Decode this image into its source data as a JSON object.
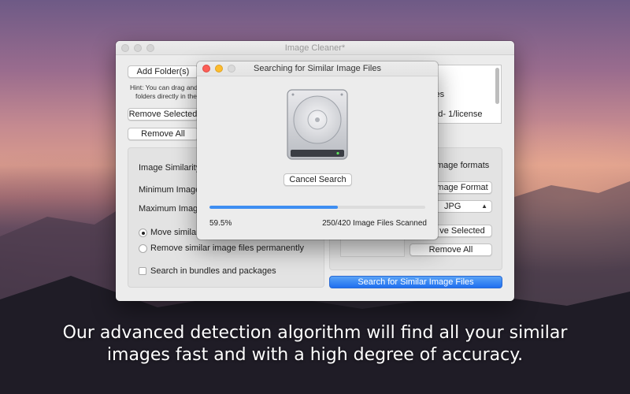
{
  "window": {
    "title": "Image Cleaner*",
    "add_folders_label": "Add Folder(s)",
    "hint_line1": "Hint: You can drag and",
    "hint_line2": "folders directly in the",
    "remove_selected_label": "Remove Selected",
    "remove_all_label": "Remove All",
    "folder_list": [
      "ples",
      "ned- 1/license"
    ],
    "left_group": {
      "image_similarity_label": "Image Similarity",
      "minimum_label": "Minimum Image",
      "maximum_label": "Maximum Image",
      "move_similar_label": "Move similar i",
      "remove_permanently_label": "Remove similar image files permanently",
      "search_bundles_label": "Search in bundles and packages"
    },
    "right_group": {
      "image_formats_label": "mage formats",
      "add_format_label": "mage Format",
      "format_value": "JPG",
      "remove_selected_label": "ve Selected",
      "remove_all_label": "Remove All"
    },
    "search_button_label": "Search for Similar Image Files"
  },
  "dialog": {
    "title": "Searching for Similar Image Files",
    "cancel_label": "Cancel Search",
    "progress": 0.595,
    "percent_text": "59.5%",
    "scanned_text": "250/420 Image Files Scanned",
    "icon": "hard-disk-icon"
  },
  "caption": {
    "line1": "Our advanced detection algorithm will find all your similar",
    "line2": "images fast and with a high degree of accuracy."
  },
  "colors": {
    "accent": "#3e8ef2",
    "close": "#fc5f57",
    "minimize": "#fdbc2e"
  }
}
